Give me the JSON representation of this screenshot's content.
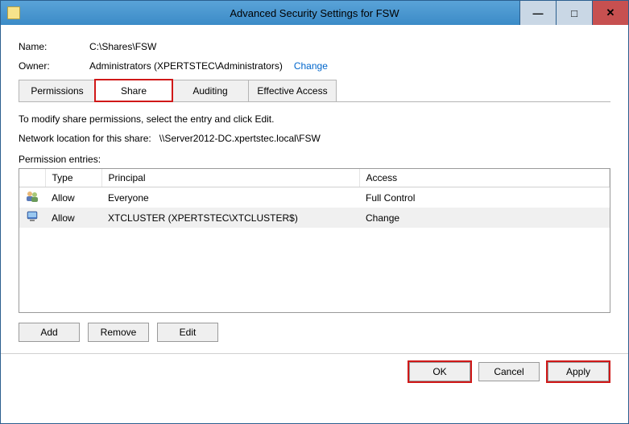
{
  "window": {
    "title": "Advanced Security Settings for FSW"
  },
  "fields": {
    "name_label": "Name:",
    "name_value": "C:\\Shares\\FSW",
    "owner_label": "Owner:",
    "owner_value": "Administrators (XPERTSTEC\\Administrators)",
    "change_link": "Change"
  },
  "tabs": {
    "permissions": "Permissions",
    "share": "Share",
    "auditing": "Auditing",
    "effective": "Effective Access"
  },
  "body": {
    "instructions": "To modify share permissions, select the entry and click Edit.",
    "netloc_label": "Network location for this share:",
    "netloc_value": "\\\\Server2012-DC.xpertstec.local\\FSW",
    "perm_entries_label": "Permission entries:"
  },
  "columns": {
    "icon": "",
    "type": "Type",
    "principal": "Principal",
    "access": "Access"
  },
  "entries": [
    {
      "type": "Allow",
      "principal": "Everyone",
      "access": "Full Control",
      "icon": "users"
    },
    {
      "type": "Allow",
      "principal": "XTCLUSTER (XPERTSTEC\\XTCLUSTER$)",
      "access": "Change",
      "icon": "computer"
    }
  ],
  "buttons": {
    "add": "Add",
    "remove": "Remove",
    "edit": "Edit",
    "ok": "OK",
    "cancel": "Cancel",
    "apply": "Apply"
  }
}
